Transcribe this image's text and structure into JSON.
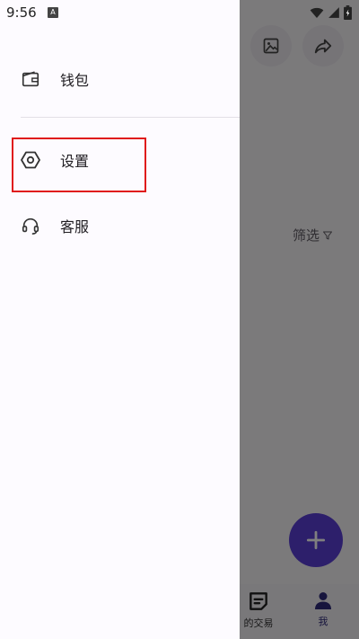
{
  "status_bar": {
    "time": "9:56",
    "notification_glyph": "A",
    "icons": [
      "wifi-icon",
      "signal-icon",
      "battery-icon"
    ]
  },
  "drawer": {
    "items": [
      {
        "label": "钱包",
        "icon": "wallet-icon"
      },
      {
        "label": "设置",
        "icon": "settings-icon"
      },
      {
        "label": "客服",
        "icon": "headset-icon"
      }
    ],
    "highlighted_item": "设置",
    "highlight_color": "#e01a1a"
  },
  "background": {
    "filter_label": "筛选",
    "top_buttons": [
      "image-icon",
      "share-icon"
    ],
    "fab_icon": "plus-icon",
    "bottom_nav": [
      {
        "label": "的交易",
        "icon": "transactions-icon"
      },
      {
        "label": "我",
        "icon": "person-icon",
        "active": true
      }
    ]
  },
  "colors": {
    "accent": "#5a3fd6",
    "active_nav": "#2e2a7a",
    "drawer_bg": "#fdfbff"
  }
}
